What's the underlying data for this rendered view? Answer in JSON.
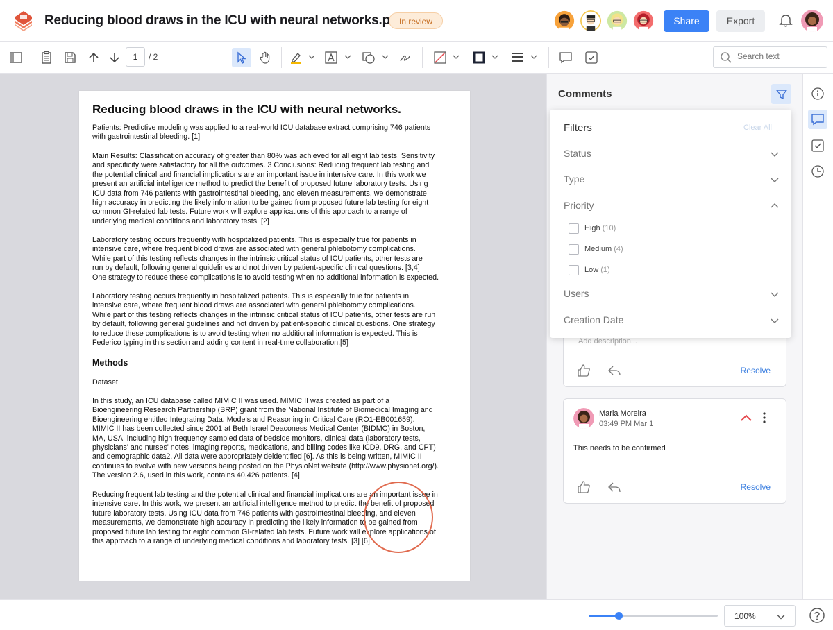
{
  "header": {
    "title": "Reducing blood draws in the ICU with neural networks.pdf",
    "status": "In review",
    "share_label": "Share",
    "export_label": "Export",
    "collaborators": [
      "avatar-1",
      "avatar-2",
      "avatar-3",
      "avatar-4"
    ]
  },
  "toolbar": {
    "page_current": "1",
    "page_total": "/ 2",
    "search_placeholder": "Search text"
  },
  "document": {
    "title": "Reducing blood draws in the ICU with neural networks.",
    "p1": "Patients: Predictive modeling was applied to a real-world ICU database extract comprising 746 patients\nwith gastrointestinal bleeding. [1]",
    "p2": "Main Results: Classification accuracy of greater than 80% was achieved for all eight lab tests. Sensitivity\nand specificity were satisfactory for all the outcomes. 3 Conclusions: Reducing frequent lab testing and\nthe potential clinical and financial implications are an important issue in intensive care. In this work we\npresent an artificial intelligence method to predict the benefit of proposed future laboratory tests. Using\nICU data from 746 patients with gastrointestinal bleeding, and eleven measurements, we demonstrate\nhigh accuracy in predicting the likely information to be gained from proposed future lab testing for eight\ncommon GI-related lab tests. Future work will explore applications of this approach to a range of\nunderlying medical conditions and laboratory tests. [2]",
    "p3": "Laboratory testing occurs frequently with hospitalized patients. This is especially true for patients in\nintensive care, where frequent blood draws are associated with general phlebotomy complications.\nWhile part of this testing reflects changes in the intrinsic critical status of ICU patients, other tests are\nrun by default, following general guidelines and not driven by patient-specific clinical questions. [3,4]\nOne strategy to reduce these complications is to avoid testing when no additional information is expected.",
    "p4": "Laboratory testing occurs frequently in hospitalized patients. This is especially true for patients in\nintensive care, where frequent blood draws are associated with general phlebotomy complications.\nWhile part of this testing reflects changes in the intrinsic critical status of ICU patients, other tests are run\nby default, following general guidelines and not driven by patient-specific clinical questions. One strategy\nto reduce these complications is to avoid testing when no additional information is expected. This is\nFederico typing in this section and adding content in real-time collaboration.[5]",
    "methods_heading": "Methods",
    "dataset_label": "Dataset",
    "p5": "In this study, an ICU database called MIMIC II was used. MIMIC II was created as part of a\nBioengineering Research Partnership (BRP) grant from the National Institute of Biomedical Imaging and\nBioengineering entitled Integrating Data, Models and Reasoning in Critical Care (RO1-EB001659).\nMIMIC II has been collected since 2001 at Beth Israel Deaconess Medical Center (BIDMC) in Boston,\nMA, USA, including high frequency sampled data of bedside monitors, clinical data (laboratory tests,\nphysicians' and nurses' notes, imaging reports, medications, and billing codes like ICD9, DRG, and CPT)\nand demographic data2. All data were appropriately deidentified [6]. As this is being written, MIMIC II\ncontinues to evolve with new versions being posted on the PhysioNet website (http://www.physionet.org/).\nThe version 2.6, used in this work, contains 40,426 patients. [4]",
    "p6": "Reducing frequent lab testing and the potential clinical and financial implications are an important issue in\nintensive care. In this work, we present an artificial intelligence method to predict the benefit of proposed\nfuture laboratory tests. Using ICU data from 746 patients with gastrointestinal bleeding, and eleven\nmeasurements, we demonstrate high accuracy in predicting the likely information to be gained from\nproposed future lab testing for eight common GI-related lab tests. Future work will explore applications of\nthis approach to a range of underlying medical conditions and laboratory tests. [3] [6]"
  },
  "comments": {
    "title": "Comments",
    "card1": {
      "description_placeholder": "Add description...",
      "resolve_label": "Resolve"
    },
    "card2": {
      "author": "Maria Moreira",
      "time": "03:49 PM Mar 1",
      "text": "This needs to be confirmed",
      "resolve_label": "Resolve"
    }
  },
  "filters": {
    "title": "Filters",
    "clear_all": "Clear All",
    "sections": {
      "status": "Status",
      "type": "Type",
      "priority": "Priority",
      "users": "Users",
      "creation_date": "Creation Date"
    },
    "priority_options": [
      {
        "label": "High",
        "count": "(10)"
      },
      {
        "label": "Medium",
        "count": "(4)"
      },
      {
        "label": "Low",
        "count": "(1)"
      }
    ]
  },
  "bottom": {
    "zoom_value": "100%",
    "zoom_slider_fraction": 0.23
  },
  "colors": {
    "accent": "#3b82f6",
    "status_badge": "#fdecd9",
    "annotation_circle": "#e06a4e",
    "priority_high": "#e5484d"
  }
}
